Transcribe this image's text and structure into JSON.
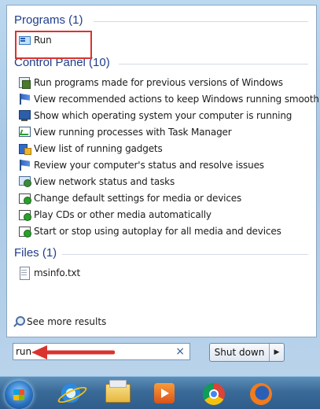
{
  "programs": {
    "header": "Programs (1)",
    "items": [
      {
        "label": "Run",
        "icon": "run-icon"
      }
    ]
  },
  "control_panel": {
    "header": "Control Panel (10)",
    "items": [
      {
        "label": "Run programs made for previous versions of Windows",
        "icon": "compatibility-icon"
      },
      {
        "label": "View recommended actions to keep Windows running smoothly",
        "icon": "action-center-flag-icon"
      },
      {
        "label": "Show which operating system your computer is running",
        "icon": "system-icon"
      },
      {
        "label": "View running processes with Task Manager",
        "icon": "task-manager-icon"
      },
      {
        "label": "View list of running gadgets",
        "icon": "gadgets-icon"
      },
      {
        "label": "Review your computer's status and resolve issues",
        "icon": "action-center-flag-icon"
      },
      {
        "label": "View network status and tasks",
        "icon": "network-icon"
      },
      {
        "label": "Change default settings for media or devices",
        "icon": "autoplay-icon"
      },
      {
        "label": "Play CDs or other media automatically",
        "icon": "autoplay-icon"
      },
      {
        "label": "Start or stop using autoplay for all media and devices",
        "icon": "autoplay-icon"
      }
    ]
  },
  "files": {
    "header": "Files (1)",
    "items": [
      {
        "label": "msinfo.txt",
        "icon": "text-file-icon"
      }
    ]
  },
  "see_more": "See more results",
  "search": {
    "value": "run",
    "clear": "×"
  },
  "shutdown": {
    "label": "Shut down",
    "arrow": "▶"
  },
  "taskbar": {
    "items": [
      "start-orb",
      "internet-explorer-icon",
      "windows-explorer-icon",
      "media-player-icon",
      "chrome-icon",
      "firefox-icon"
    ]
  },
  "colors": {
    "highlight": "#d9332f",
    "header": "#1e3d8c"
  }
}
